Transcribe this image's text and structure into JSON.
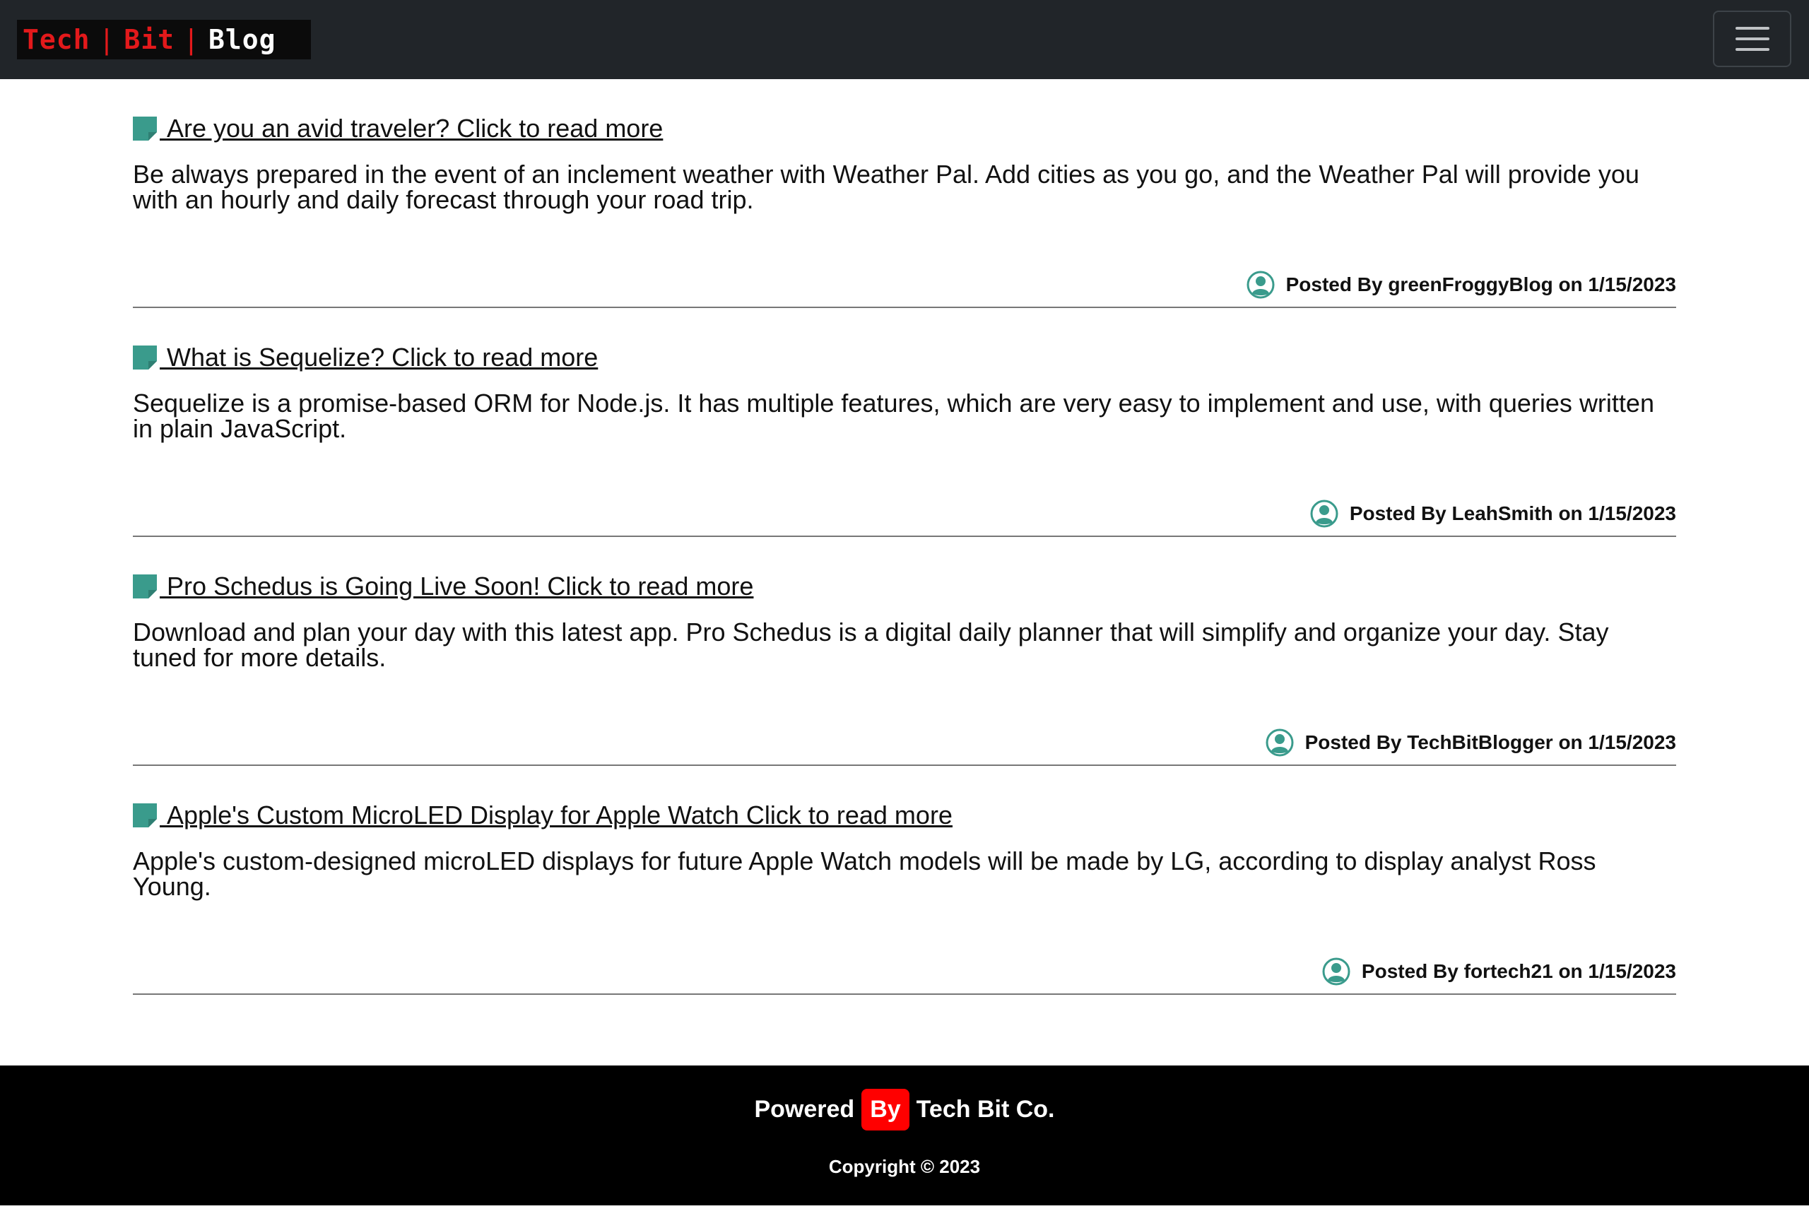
{
  "navbar": {
    "brand": {
      "word1": "Tech",
      "sep1": "|",
      "word2": "Bit",
      "sep2": "|",
      "word3": "Blog"
    },
    "toggler_icon": "hamburger-menu-icon"
  },
  "posts": [
    {
      "title": "Are you an avid traveler? Click to read more",
      "body": "Be always prepared in the event of an inclement weather with Weather Pal. Add cities as you go, and the Weather Pal will provide you with an hourly and daily forecast through your road trip.",
      "meta": "Posted By greenFroggyBlog on 1/15/2023"
    },
    {
      "title": "What is Sequelize? Click to read more",
      "body": "Sequelize is a promise-based ORM for Node.js. It has multiple features, which are very easy to implement and use, with queries written in plain JavaScript.",
      "meta": "Posted By LeahSmith on 1/15/2023"
    },
    {
      "title": "Pro Schedus is Going Live Soon! Click to read more",
      "body": "Download and plan your day with this latest app. Pro Schedus is a digital daily planner that will simplify and organize your day. Stay tuned for more details.",
      "meta": "Posted By TechBitBlogger on 1/15/2023"
    },
    {
      "title": "Apple's Custom MicroLED Display for Apple Watch Click to read more",
      "body": "Apple's custom-designed microLED displays for future Apple Watch models will be made by LG, according to display analyst Ross Young.",
      "meta": "Posted By fortech21 on 1/15/2023"
    }
  ],
  "footer": {
    "powered": "Powered",
    "by": "By",
    "company": "Tech Bit Co.",
    "copyright": "Copyright © 2023"
  },
  "colors": {
    "navbar_bg": "#212529",
    "brand_red": "#e3191b",
    "icon_teal": "#3a9b8c",
    "footer_bg": "#000000",
    "badge_red": "#ff0000"
  },
  "icons": {
    "post_icon": "sticky-note-icon",
    "author_icon": "user-circle-icon"
  }
}
